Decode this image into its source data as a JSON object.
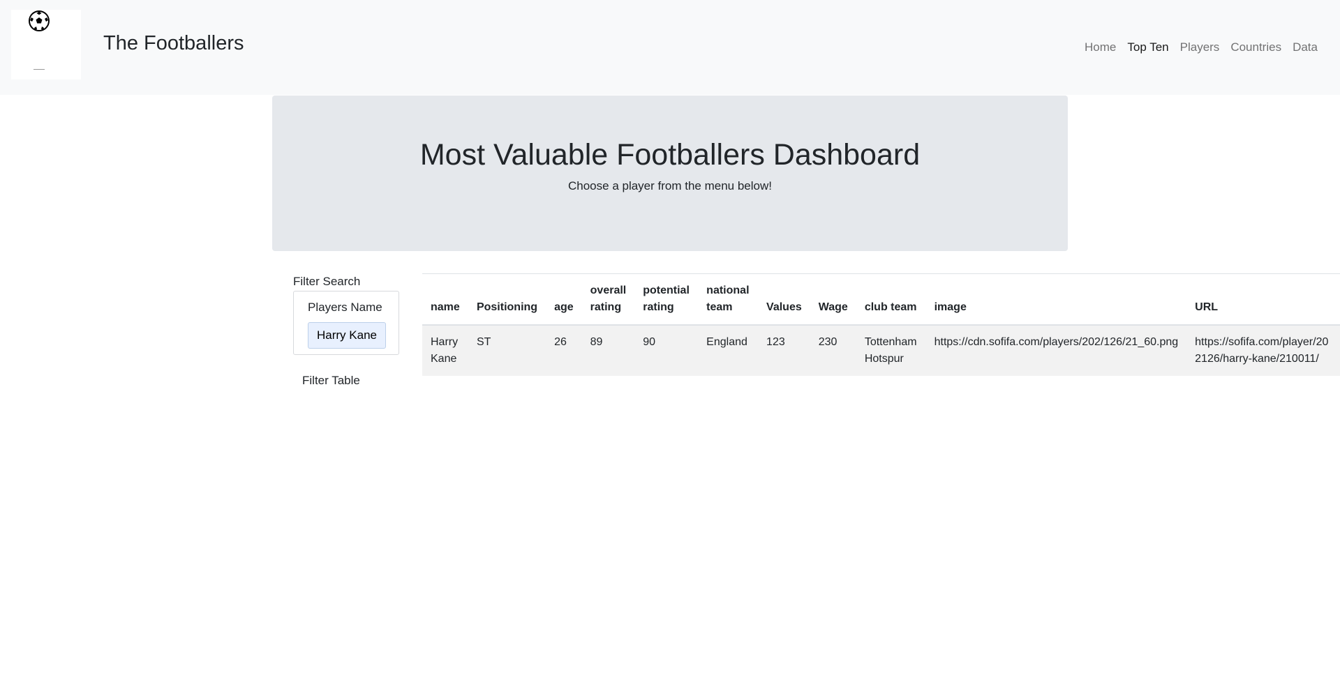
{
  "navbar": {
    "brand": "The Footballers",
    "logo_icon": "soccer-ball-icon",
    "links": [
      {
        "label": "Home",
        "active": false
      },
      {
        "label": "Top Ten",
        "active": true
      },
      {
        "label": "Players",
        "active": false
      },
      {
        "label": "Countries",
        "active": false
      },
      {
        "label": "Data",
        "active": false
      }
    ]
  },
  "jumbotron": {
    "title": "Most Valuable Footballers Dashboard",
    "subtitle": "Choose a player from the menu below!"
  },
  "filter": {
    "title": "Filter Search",
    "field_label": "Players Name",
    "field_value": "Harry Kane",
    "button_label": "Filter Table"
  },
  "table": {
    "headers": [
      "name",
      "Positioning",
      "age",
      "overall rating",
      "potential rating",
      "national team",
      "Values",
      "Wage",
      "club team",
      "image",
      "URL"
    ],
    "rows": [
      [
        "Harry Kane",
        "ST",
        "26",
        "89",
        "90",
        "England",
        "123",
        "230",
        "Tottenham Hotspur",
        "https://cdn.sofifa.com/players/202/126/21_60.png",
        "https://sofifa.com/player/202126/harry-kane/210011/"
      ]
    ]
  },
  "colors": {
    "navbar_bg": "#f8f9fa",
    "jumbotron_bg": "#e5e8ec",
    "row_bg": "#f2f2f2"
  }
}
